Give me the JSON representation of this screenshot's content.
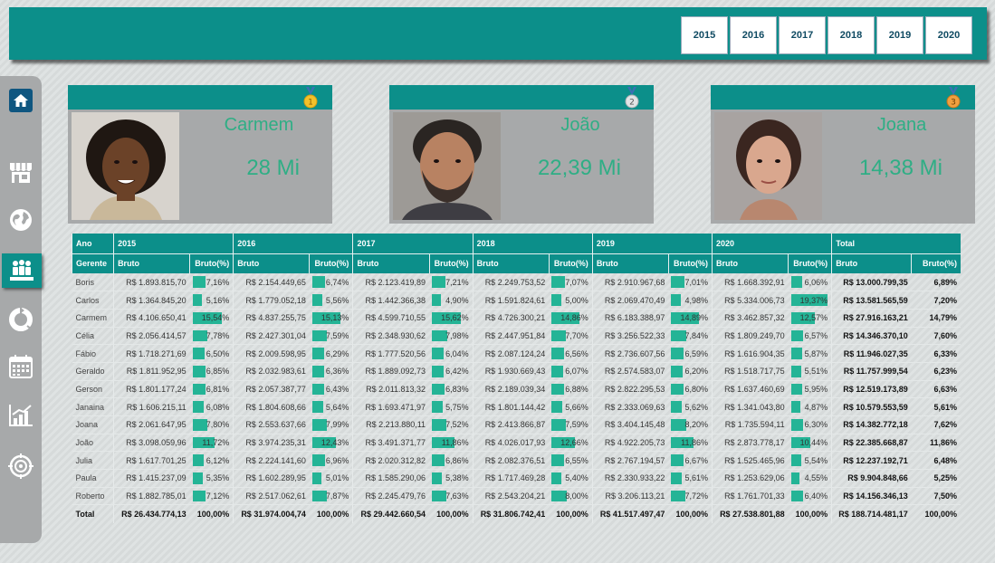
{
  "years": [
    "2015",
    "2016",
    "2017",
    "2018",
    "2019",
    "2020"
  ],
  "colors": {
    "teal": "#0c8f8a",
    "bar": "#24b496",
    "accent_text": "#2fae85"
  },
  "nav": [
    "home-icon",
    "store-icon",
    "globe-icon",
    "people-icon",
    "pie-chart-icon",
    "calendar-icon",
    "bar-chart-icon",
    "target-icon"
  ],
  "cards": [
    {
      "name": "Carmem",
      "value": "28 Mi",
      "medal": "gold-medal-icon",
      "rank": "1"
    },
    {
      "name": "João",
      "value": "22,39 Mi",
      "medal": "silver-medal-icon",
      "rank": "2"
    },
    {
      "name": "Joana",
      "value": "14,38 Mi",
      "medal": "bronze-medal-icon",
      "rank": "3"
    }
  ],
  "table": {
    "header_year": "Ano",
    "header_manager": "Gerente",
    "header_gross": "Bruto",
    "header_gross_pct": "Bruto(%)",
    "header_total": "Total",
    "rows": [
      {
        "name": "Boris",
        "values": [
          "R$ 1.893.815,70",
          "7,16%",
          "R$ 2.154.449,65",
          "6,74%",
          "R$ 2.123.419,89",
          "7,21%",
          "R$ 2.249.753,52",
          "7,07%",
          "R$ 2.910.967,68",
          "7,01%",
          "R$ 1.668.392,91",
          "6,06%"
        ],
        "pcts": [
          7.16,
          6.74,
          7.21,
          7.07,
          7.01,
          6.06
        ],
        "total": "R$ 13.000.799,35",
        "total_pct": "6,89%"
      },
      {
        "name": "Carlos",
        "values": [
          "R$ 1.364.845,20",
          "5,16%",
          "R$ 1.779.052,18",
          "5,56%",
          "R$ 1.442.366,38",
          "4,90%",
          "R$ 1.591.824,61",
          "5,00%",
          "R$ 2.069.470,49",
          "4,98%",
          "R$ 5.334.006,73",
          "19,37%"
        ],
        "pcts": [
          5.16,
          5.56,
          4.9,
          5.0,
          4.98,
          19.37
        ],
        "total": "R$ 13.581.565,59",
        "total_pct": "7,20%"
      },
      {
        "name": "Carmem",
        "values": [
          "R$ 4.106.650,41",
          "15,54%",
          "R$ 4.837.255,75",
          "15,13%",
          "R$ 4.599.710,55",
          "15,62%",
          "R$ 4.726.300,21",
          "14,86%",
          "R$ 6.183.388,97",
          "14,89%",
          "R$ 3.462.857,32",
          "12,57%"
        ],
        "pcts": [
          15.54,
          15.13,
          15.62,
          14.86,
          14.89,
          12.57
        ],
        "total": "R$ 27.916.163,21",
        "total_pct": "14,79%"
      },
      {
        "name": "Célia",
        "values": [
          "R$ 2.056.414,57",
          "7,78%",
          "R$ 2.427.301,04",
          "7,59%",
          "R$ 2.348.930,62",
          "7,98%",
          "R$ 2.447.951,84",
          "7,70%",
          "R$ 3.256.522,33",
          "7,84%",
          "R$ 1.809.249,70",
          "6,57%"
        ],
        "pcts": [
          7.78,
          7.59,
          7.98,
          7.7,
          7.84,
          6.57
        ],
        "total": "R$ 14.346.370,10",
        "total_pct": "7,60%"
      },
      {
        "name": "Fábio",
        "values": [
          "R$ 1.718.271,69",
          "6,50%",
          "R$ 2.009.598,95",
          "6,29%",
          "R$ 1.777.520,56",
          "6,04%",
          "R$ 2.087.124,24",
          "6,56%",
          "R$ 2.736.607,56",
          "6,59%",
          "R$ 1.616.904,35",
          "5,87%"
        ],
        "pcts": [
          6.5,
          6.29,
          6.04,
          6.56,
          6.59,
          5.87
        ],
        "total": "R$ 11.946.027,35",
        "total_pct": "6,33%"
      },
      {
        "name": "Geraldo",
        "values": [
          "R$ 1.811.952,95",
          "6,85%",
          "R$ 2.032.983,61",
          "6,36%",
          "R$ 1.889.092,73",
          "6,42%",
          "R$ 1.930.669,43",
          "6,07%",
          "R$ 2.574.583,07",
          "6,20%",
          "R$ 1.518.717,75",
          "5,51%"
        ],
        "pcts": [
          6.85,
          6.36,
          6.42,
          6.07,
          6.2,
          5.51
        ],
        "total": "R$ 11.757.999,54",
        "total_pct": "6,23%"
      },
      {
        "name": "Gerson",
        "values": [
          "R$ 1.801.177,24",
          "6,81%",
          "R$ 2.057.387,77",
          "6,43%",
          "R$ 2.011.813,32",
          "6,83%",
          "R$ 2.189.039,34",
          "6,88%",
          "R$ 2.822.295,53",
          "6,80%",
          "R$ 1.637.460,69",
          "5,95%"
        ],
        "pcts": [
          6.81,
          6.43,
          6.83,
          6.88,
          6.8,
          5.95
        ],
        "total": "R$ 12.519.173,89",
        "total_pct": "6,63%"
      },
      {
        "name": "Janaina",
        "values": [
          "R$ 1.606.215,11",
          "6,08%",
          "R$ 1.804.608,66",
          "5,64%",
          "R$ 1.693.471,97",
          "5,75%",
          "R$ 1.801.144,42",
          "5,66%",
          "R$ 2.333.069,63",
          "5,62%",
          "R$ 1.341.043,80",
          "4,87%"
        ],
        "pcts": [
          6.08,
          5.64,
          5.75,
          5.66,
          5.62,
          4.87
        ],
        "total": "R$ 10.579.553,59",
        "total_pct": "5,61%"
      },
      {
        "name": "Joana",
        "values": [
          "R$ 2.061.647,95",
          "7,80%",
          "R$ 2.553.637,66",
          "7,99%",
          "R$ 2.213.880,11",
          "7,52%",
          "R$ 2.413.866,87",
          "7,59%",
          "R$ 3.404.145,48",
          "8,20%",
          "R$ 1.735.594,11",
          "6,30%"
        ],
        "pcts": [
          7.8,
          7.99,
          7.52,
          7.59,
          8.2,
          6.3
        ],
        "total": "R$ 14.382.772,18",
        "total_pct": "7,62%"
      },
      {
        "name": "João",
        "values": [
          "R$ 3.098.059,96",
          "11,72%",
          "R$ 3.974.235,31",
          "12,43%",
          "R$ 3.491.371,77",
          "11,86%",
          "R$ 4.026.017,93",
          "12,66%",
          "R$ 4.922.205,73",
          "11,86%",
          "R$ 2.873.778,17",
          "10,44%"
        ],
        "pcts": [
          11.72,
          12.43,
          11.86,
          12.66,
          11.86,
          10.44
        ],
        "total": "R$ 22.385.668,87",
        "total_pct": "11,86%"
      },
      {
        "name": "Julia",
        "values": [
          "R$ 1.617.701,25",
          "6,12%",
          "R$ 2.224.141,60",
          "6,96%",
          "R$ 2.020.312,82",
          "6,86%",
          "R$ 2.082.376,51",
          "6,55%",
          "R$ 2.767.194,57",
          "6,67%",
          "R$ 1.525.465,96",
          "5,54%"
        ],
        "pcts": [
          6.12,
          6.96,
          6.86,
          6.55,
          6.67,
          5.54
        ],
        "total": "R$ 12.237.192,71",
        "total_pct": "6,48%"
      },
      {
        "name": "Paula",
        "values": [
          "R$ 1.415.237,09",
          "5,35%",
          "R$ 1.602.289,95",
          "5,01%",
          "R$ 1.585.290,06",
          "5,38%",
          "R$ 1.717.469,28",
          "5,40%",
          "R$ 2.330.933,22",
          "5,61%",
          "R$ 1.253.629,06",
          "4,55%"
        ],
        "pcts": [
          5.35,
          5.01,
          5.38,
          5.4,
          5.61,
          4.55
        ],
        "total": "R$ 9.904.848,66",
        "total_pct": "5,25%"
      },
      {
        "name": "Roberto",
        "values": [
          "R$ 1.882.785,01",
          "7,12%",
          "R$ 2.517.062,61",
          "7,87%",
          "R$ 2.245.479,76",
          "7,63%",
          "R$ 2.543.204,21",
          "8,00%",
          "R$ 3.206.113,21",
          "7,72%",
          "R$ 1.761.701,33",
          "6,40%"
        ],
        "pcts": [
          7.12,
          7.87,
          7.63,
          8.0,
          7.72,
          6.4
        ],
        "total": "R$ 14.156.346,13",
        "total_pct": "7,50%"
      }
    ],
    "total_row": {
      "label": "Total",
      "values": [
        "R$ 26.434.774,13",
        "100,00%",
        "R$ 31.974.004,74",
        "100,00%",
        "R$ 29.442.660,54",
        "100,00%",
        "R$ 31.806.742,41",
        "100,00%",
        "R$ 41.517.497,47",
        "100,00%",
        "R$ 27.538.801,88",
        "100,00%"
      ],
      "total": "R$ 188.714.481,17",
      "total_pct": "100,00%"
    }
  }
}
